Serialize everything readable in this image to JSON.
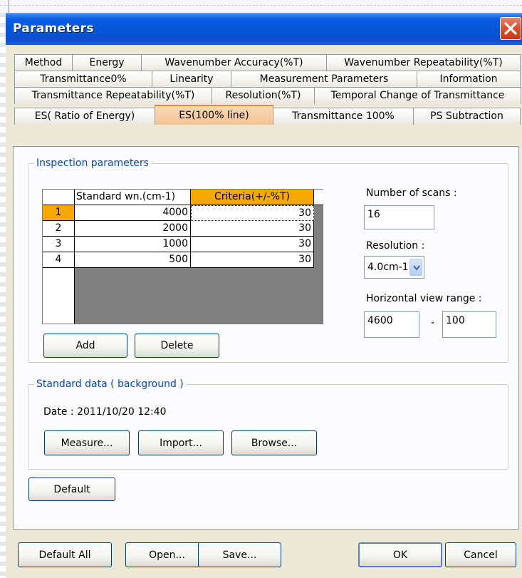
{
  "window": {
    "title": "Parameters"
  },
  "tabs": {
    "row1": [
      "Method",
      "Energy",
      "Wavenumber Accuracy(%T)",
      "Wavenumber Repeatability(%T)"
    ],
    "row2": [
      "Transmittance0%",
      "Linearity",
      "Measurement Parameters",
      "Information"
    ],
    "row3": [
      "Transmittance Repeatability(%T)",
      "Resolution(%T)",
      "Temporal Change of Transmittance"
    ],
    "row4": [
      "ES( Ratio of Energy)",
      "ES(100% line)",
      "Transmittance 100%",
      "PS Subtraction"
    ],
    "active": "ES(100% line)"
  },
  "inspection": {
    "group_label": "Inspection parameters",
    "columns": [
      "Standard wn.(cm-1)",
      "Criteria(+/-%T)"
    ],
    "rows": [
      {
        "index": "1",
        "wn": "4000",
        "criteria": "30"
      },
      {
        "index": "2",
        "wn": "2000",
        "criteria": "30"
      },
      {
        "index": "3",
        "wn": "1000",
        "criteria": "30"
      },
      {
        "index": "4",
        "wn": "500",
        "criteria": "30"
      }
    ],
    "add_label": "Add",
    "delete_label": "Delete",
    "scans_label": "Number of scans :",
    "scans_value": "16",
    "resolution_label": "Resolution :",
    "resolution_value": "4.0cm-1",
    "range_label": "Horizontal view range :",
    "range_from": "4600",
    "range_sep": "-",
    "range_to": "100"
  },
  "standard": {
    "group_label": "Standard data ( background )",
    "date_text": "Date : 2011/10/20 12:40",
    "measure_label": "Measure...",
    "import_label": "Import...",
    "browse_label": "Browse..."
  },
  "default_label": "Default",
  "bottom": {
    "default_all_label": "Default All",
    "open_label": "Open...",
    "save_label": "Save...",
    "ok_label": "OK",
    "cancel_label": "Cancel"
  },
  "colors": {
    "titlebar": "#0554d8",
    "selected_header": "#f8a800",
    "active_tab": "#f3c394",
    "group_label": "#0046d5"
  }
}
